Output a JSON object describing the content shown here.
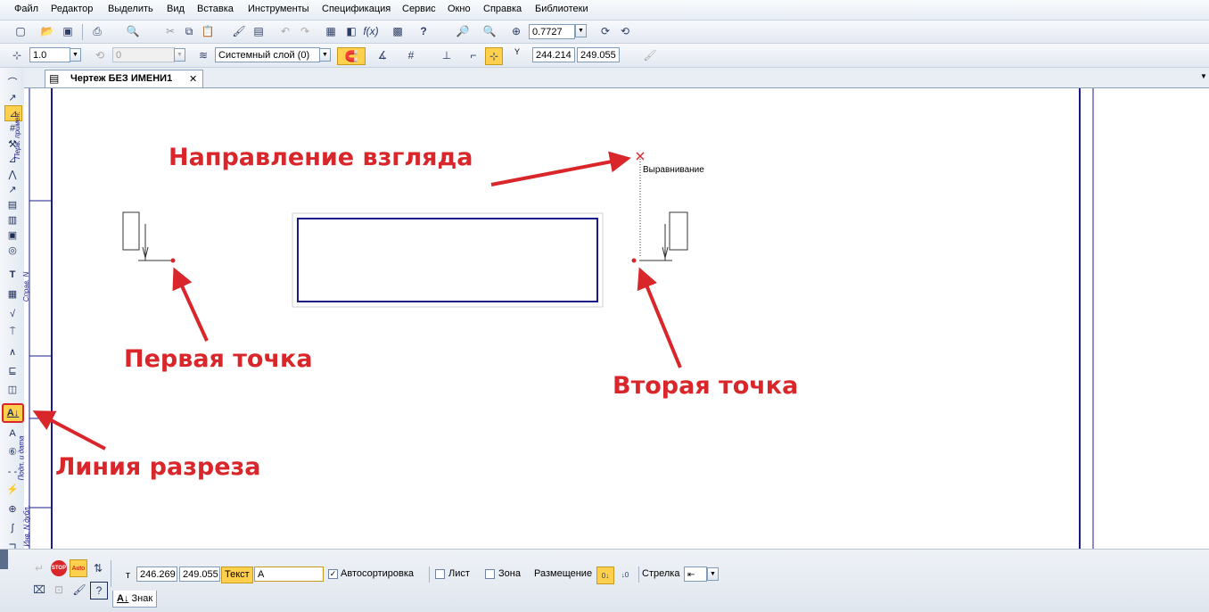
{
  "menu": [
    "Файл",
    "Редактор",
    "Выделить",
    "Вид",
    "Вставка",
    "Инструменты",
    "Спецификация",
    "Сервис",
    "Окно",
    "Справка",
    "Библиотеки"
  ],
  "toolbar1": {
    "zoom_value": "0.7727"
  },
  "toolbar2": {
    "line_scale": "1.0",
    "angle_value": "0",
    "layer": "Системный слой (0)",
    "coord_y_prefix": "Y",
    "coord_x_value": "244.214",
    "coord_y_value": "249.055"
  },
  "tab": {
    "title": "Чертеж БЕЗ ИМЕНИ1",
    "close": "✕"
  },
  "drawing": {
    "alignment_hint": "Выравнивание",
    "frame_label_top": "Перв. примен.",
    "frame_label_mid": "Справ. N",
    "frame_label_bottom": "Подп. и дата",
    "frame_label_last": "Инв. N дубл."
  },
  "annotations": {
    "view_direction": "Направление взгляда",
    "first_point": "Первая точка",
    "second_point": "Вторая точка",
    "section_line": "Линия разреза"
  },
  "properties": {
    "point_label": "т",
    "point_x": "246.269",
    "point_y": "249.055",
    "text_label": "Текст",
    "text_value": "А",
    "autosort_label": "Автосортировка",
    "autosort_checked": true,
    "sheet_label": "Лист",
    "zone_label": "Зона",
    "placement_label": "Размещение",
    "arrow_label": "Стрелка",
    "tab_sign": "Знак",
    "tab_sign_icon": "А↓"
  },
  "colors": {
    "annotation_red": "#d9262b",
    "drawing_blue": "#1a1a8c",
    "highlight": "#ffd04d"
  }
}
